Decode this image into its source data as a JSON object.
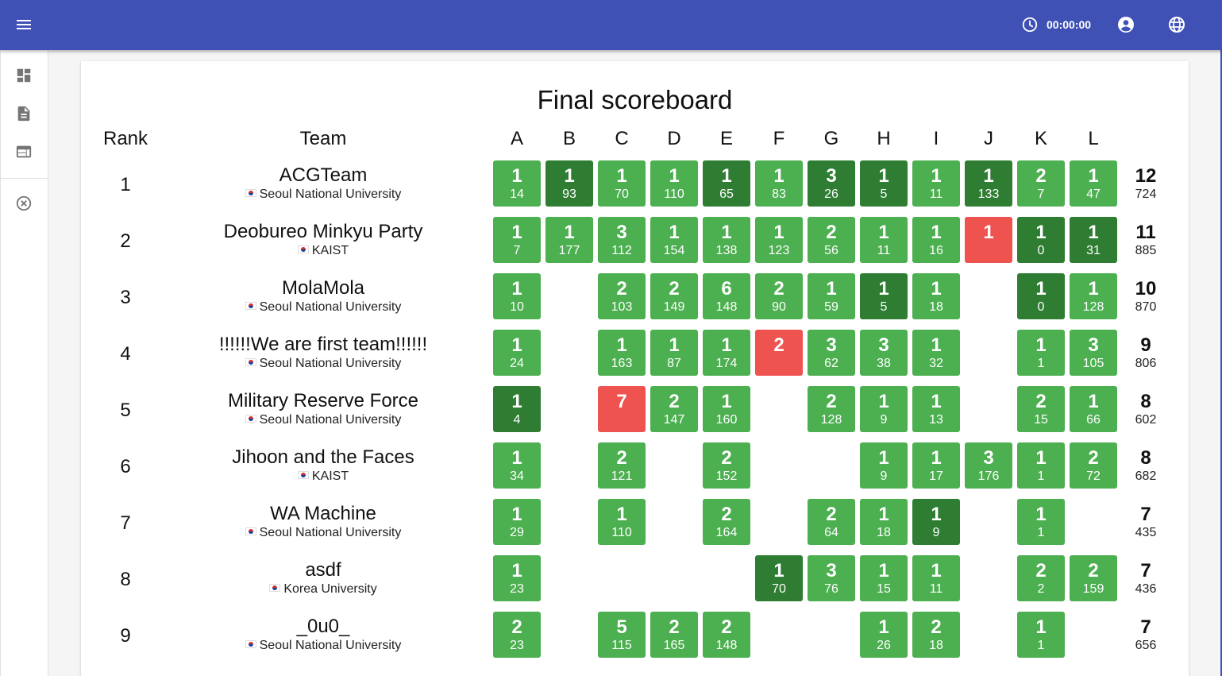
{
  "header": {
    "timer": "00:00:00"
  },
  "sidebar": {
    "items": [
      "dashboard-icon",
      "document-icon",
      "scoreboard-icon",
      "close-circle-icon"
    ]
  },
  "scoreboard": {
    "title": "Final scoreboard",
    "rank_label": "Rank",
    "team_label": "Team",
    "problems": [
      "A",
      "B",
      "C",
      "D",
      "E",
      "F",
      "G",
      "H",
      "I",
      "J",
      "K",
      "L"
    ],
    "rows": [
      {
        "rank": "1",
        "team": "ACGTeam",
        "univ": "Seoul National University",
        "solved": "12",
        "penalty": "724",
        "cells": [
          [
            "s",
            "1",
            "14"
          ],
          [
            "f",
            "1",
            "93"
          ],
          [
            "s",
            "1",
            "70"
          ],
          [
            "s",
            "1",
            "110"
          ],
          [
            "f",
            "1",
            "65"
          ],
          [
            "s",
            "1",
            "83"
          ],
          [
            "f",
            "3",
            "26"
          ],
          [
            "f",
            "1",
            "5"
          ],
          [
            "s",
            "1",
            "11"
          ],
          [
            "f",
            "1",
            "133"
          ],
          [
            "s",
            "2",
            "7"
          ],
          [
            "s",
            "1",
            "47"
          ]
        ]
      },
      {
        "rank": "2",
        "team": "Deobureo Minkyu Party",
        "univ": "KAIST",
        "solved": "11",
        "penalty": "885",
        "cells": [
          [
            "s",
            "1",
            "7"
          ],
          [
            "s",
            "1",
            "177"
          ],
          [
            "s",
            "3",
            "112"
          ],
          [
            "s",
            "1",
            "154"
          ],
          [
            "s",
            "1",
            "138"
          ],
          [
            "s",
            "1",
            "123"
          ],
          [
            "s",
            "2",
            "56"
          ],
          [
            "s",
            "1",
            "11"
          ],
          [
            "s",
            "1",
            "16"
          ],
          [
            "w",
            "1",
            ""
          ],
          [
            "f",
            "1",
            "0"
          ],
          [
            "f",
            "1",
            "31"
          ]
        ]
      },
      {
        "rank": "3",
        "team": "MolaMola",
        "univ": "Seoul National University",
        "solved": "10",
        "penalty": "870",
        "cells": [
          [
            "s",
            "1",
            "10"
          ],
          null,
          [
            "s",
            "2",
            "103"
          ],
          [
            "s",
            "2",
            "149"
          ],
          [
            "s",
            "6",
            "148"
          ],
          [
            "s",
            "2",
            "90"
          ],
          [
            "s",
            "1",
            "59"
          ],
          [
            "f",
            "1",
            "5"
          ],
          [
            "s",
            "1",
            "18"
          ],
          null,
          [
            "f",
            "1",
            "0"
          ],
          [
            "s",
            "1",
            "128"
          ]
        ]
      },
      {
        "rank": "4",
        "team": "!!!!!!We are first team!!!!!!",
        "univ": "Seoul National University",
        "solved": "9",
        "penalty": "806",
        "cells": [
          [
            "s",
            "1",
            "24"
          ],
          null,
          [
            "s",
            "1",
            "163"
          ],
          [
            "s",
            "1",
            "87"
          ],
          [
            "s",
            "1",
            "174"
          ],
          [
            "w",
            "2",
            ""
          ],
          [
            "s",
            "3",
            "62"
          ],
          [
            "s",
            "3",
            "38"
          ],
          [
            "s",
            "1",
            "32"
          ],
          null,
          [
            "s",
            "1",
            "1"
          ],
          [
            "s",
            "3",
            "105"
          ]
        ]
      },
      {
        "rank": "5",
        "team": "Military Reserve Force",
        "univ": "Seoul National University",
        "solved": "8",
        "penalty": "602",
        "cells": [
          [
            "f",
            "1",
            "4"
          ],
          null,
          [
            "w",
            "7",
            ""
          ],
          [
            "s",
            "2",
            "147"
          ],
          [
            "s",
            "1",
            "160"
          ],
          null,
          [
            "s",
            "2",
            "128"
          ],
          [
            "s",
            "1",
            "9"
          ],
          [
            "s",
            "1",
            "13"
          ],
          null,
          [
            "s",
            "2",
            "15"
          ],
          [
            "s",
            "1",
            "66"
          ]
        ]
      },
      {
        "rank": "6",
        "team": "Jihoon and the Faces",
        "univ": "KAIST",
        "solved": "8",
        "penalty": "682",
        "cells": [
          [
            "s",
            "1",
            "34"
          ],
          null,
          [
            "s",
            "2",
            "121"
          ],
          null,
          [
            "s",
            "2",
            "152"
          ],
          null,
          null,
          [
            "s",
            "1",
            "9"
          ],
          [
            "s",
            "1",
            "17"
          ],
          [
            "s",
            "3",
            "176"
          ],
          [
            "s",
            "1",
            "1"
          ],
          [
            "s",
            "2",
            "72"
          ]
        ]
      },
      {
        "rank": "7",
        "team": "WA Machine",
        "univ": "Seoul National University",
        "solved": "7",
        "penalty": "435",
        "cells": [
          [
            "s",
            "1",
            "29"
          ],
          null,
          [
            "s",
            "1",
            "110"
          ],
          null,
          [
            "s",
            "2",
            "164"
          ],
          null,
          [
            "s",
            "2",
            "64"
          ],
          [
            "s",
            "1",
            "18"
          ],
          [
            "f",
            "1",
            "9"
          ],
          null,
          [
            "s",
            "1",
            "1"
          ],
          null
        ]
      },
      {
        "rank": "8",
        "team": "asdf",
        "univ": "Korea University",
        "solved": "7",
        "penalty": "436",
        "cells": [
          [
            "s",
            "1",
            "23"
          ],
          null,
          null,
          null,
          null,
          [
            "f",
            "1",
            "70"
          ],
          [
            "s",
            "3",
            "76"
          ],
          [
            "s",
            "1",
            "15"
          ],
          [
            "s",
            "1",
            "11"
          ],
          null,
          [
            "s",
            "2",
            "2"
          ],
          [
            "s",
            "2",
            "159"
          ]
        ]
      },
      {
        "rank": "9",
        "team": "_0u0_",
        "univ": "Seoul National University",
        "solved": "7",
        "penalty": "656",
        "cells": [
          [
            "s",
            "2",
            "23"
          ],
          null,
          [
            "s",
            "5",
            "115"
          ],
          [
            "s",
            "2",
            "165"
          ],
          [
            "s",
            "2",
            "148"
          ],
          null,
          null,
          [
            "s",
            "1",
            "26"
          ],
          [
            "s",
            "2",
            "18"
          ],
          null,
          [
            "s",
            "1",
            "1"
          ],
          null
        ]
      }
    ]
  },
  "colors": {
    "appbar": "#3f51b5",
    "solved": "#4caf50",
    "first_solve": "#2e7d32",
    "wrong": "#ef5350"
  }
}
